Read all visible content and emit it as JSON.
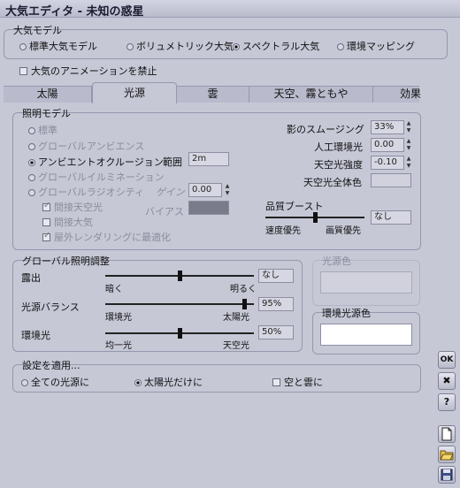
{
  "window": {
    "title": "大気エディタ - 未知の惑星"
  },
  "atmosphere": {
    "legend": "大気モデル",
    "options": [
      "標準大気モデル",
      "ボリュメトリック大気",
      "スペクトラル大気",
      "環境マッピング"
    ],
    "selected": "スペクトラル大気",
    "disable_anim_label": "大気のアニメーションを禁止",
    "disable_anim": false
  },
  "tabs": [
    {
      "label": "太陽",
      "active": false
    },
    {
      "label": "光源",
      "active": true
    },
    {
      "label": "雲",
      "active": false
    },
    {
      "label": "天空、霧ともや",
      "active": false
    },
    {
      "label": "効果",
      "active": false
    }
  ],
  "lighting": {
    "legend": "照明モデル",
    "models": [
      "標準",
      "グローバルアンビエンス",
      "アンビエントオクルージョン",
      "グローバルイルミネーション",
      "グローバルラジオシティ"
    ],
    "selected": "アンビエントオクルージョン",
    "range_label": "範囲",
    "range_value": "2m",
    "gain_label": "ゲイン",
    "gain_value": "0.00",
    "indirect_sky_label": "間接天空光",
    "indirect_sky": true,
    "indirect_atmo_label": "間接大気",
    "indirect_atmo": false,
    "outdoor_opt_label": "屋外レンダリングに最適化",
    "outdoor_opt": true,
    "bias_label": "バイアス",
    "bias_color": "#7a7b8a",
    "shadow_smooth_label": "影のスムージング",
    "shadow_smooth_value": "33%",
    "artificial_label": "人工環境光",
    "artificial_value": "0.00",
    "sky_intensity_label": "天空光強度",
    "sky_intensity_value": "-0.10",
    "sky_overall_label": "天空光全体色",
    "sky_overall_color": "#d0d1dc",
    "quality_label": "品質ブースト",
    "quality_left": "速度優先",
    "quality_right": "画質優先",
    "quality_value": "なし",
    "quality_level": 0.5
  },
  "global": {
    "legend": "グローバル照明調整",
    "exposure_label": "露出",
    "exposure_left": "暗く",
    "exposure_right": "明るく",
    "exposure_value": "なし",
    "exposure_level": 0.5,
    "balance_label": "光源バランス",
    "balance_left": "環境光",
    "balance_right": "太陽光",
    "balance_value": "95%",
    "balance_level": 0.95,
    "ambient_label": "環境光",
    "ambient_left": "均一光",
    "ambient_right": "天空光",
    "ambient_value": "50%",
    "ambient_level": 0.5
  },
  "light_color": {
    "legend": "光源色",
    "color": "#d0d1dc"
  },
  "ambient_color": {
    "legend": "環境光源色",
    "color": "#ffffff"
  },
  "apply": {
    "legend": "設定を適用...",
    "options": [
      "全ての光源に",
      "太陽光だけに"
    ],
    "selected": "太陽光だけに",
    "sky_clouds_label": "空と雲に",
    "sky_clouds": false
  },
  "side_buttons": {
    "ok": "OK",
    "cancel": "✖",
    "help": "?"
  },
  "colors": {
    "bg": "#c6c8d6",
    "field": "#d6d7e2",
    "border": "#9598ad"
  }
}
